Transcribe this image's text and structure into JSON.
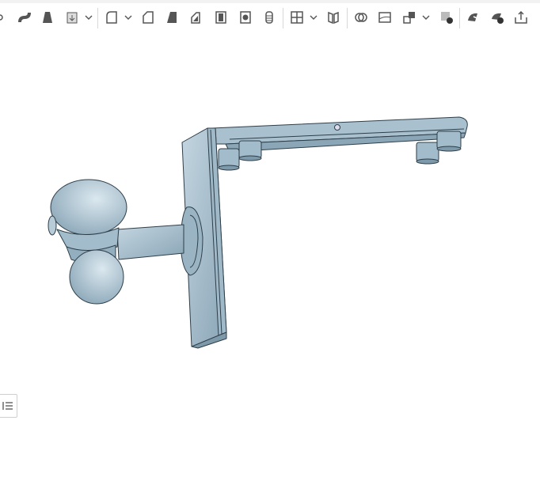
{
  "toolbar": {
    "tools": [
      {
        "name": "revolve-icon",
        "chevron": false
      },
      {
        "name": "sweep-icon",
        "chevron": false
      },
      {
        "name": "loft-icon",
        "chevron": false
      },
      {
        "name": "thicken-icon",
        "chevron": true
      },
      {
        "name": "fillet-icon",
        "chevron": true
      },
      {
        "name": "chamfer-icon",
        "chevron": false
      },
      {
        "name": "draft-icon",
        "chevron": false
      },
      {
        "name": "rib-icon",
        "chevron": false
      },
      {
        "name": "shell-icon",
        "chevron": false
      },
      {
        "name": "hole-icon",
        "chevron": false
      },
      {
        "name": "thread-icon",
        "chevron": false
      },
      {
        "name": "pattern-icon",
        "chevron": true
      },
      {
        "name": "mirror-icon",
        "chevron": false
      },
      {
        "name": "boolean-icon",
        "chevron": false
      },
      {
        "name": "split-icon",
        "chevron": false
      },
      {
        "name": "transform-icon",
        "chevron": true
      },
      {
        "name": "delete-part-icon",
        "chevron": false
      },
      {
        "name": "move-face-icon",
        "chevron": false
      },
      {
        "name": "delete-face-icon",
        "chevron": false
      },
      {
        "name": "export-icon",
        "chevron": false
      }
    ]
  },
  "colors": {
    "part_fill": "#a6bfce",
    "part_shade": "#7e99aa",
    "edge": "#2e3e49",
    "icon": "#555555"
  }
}
